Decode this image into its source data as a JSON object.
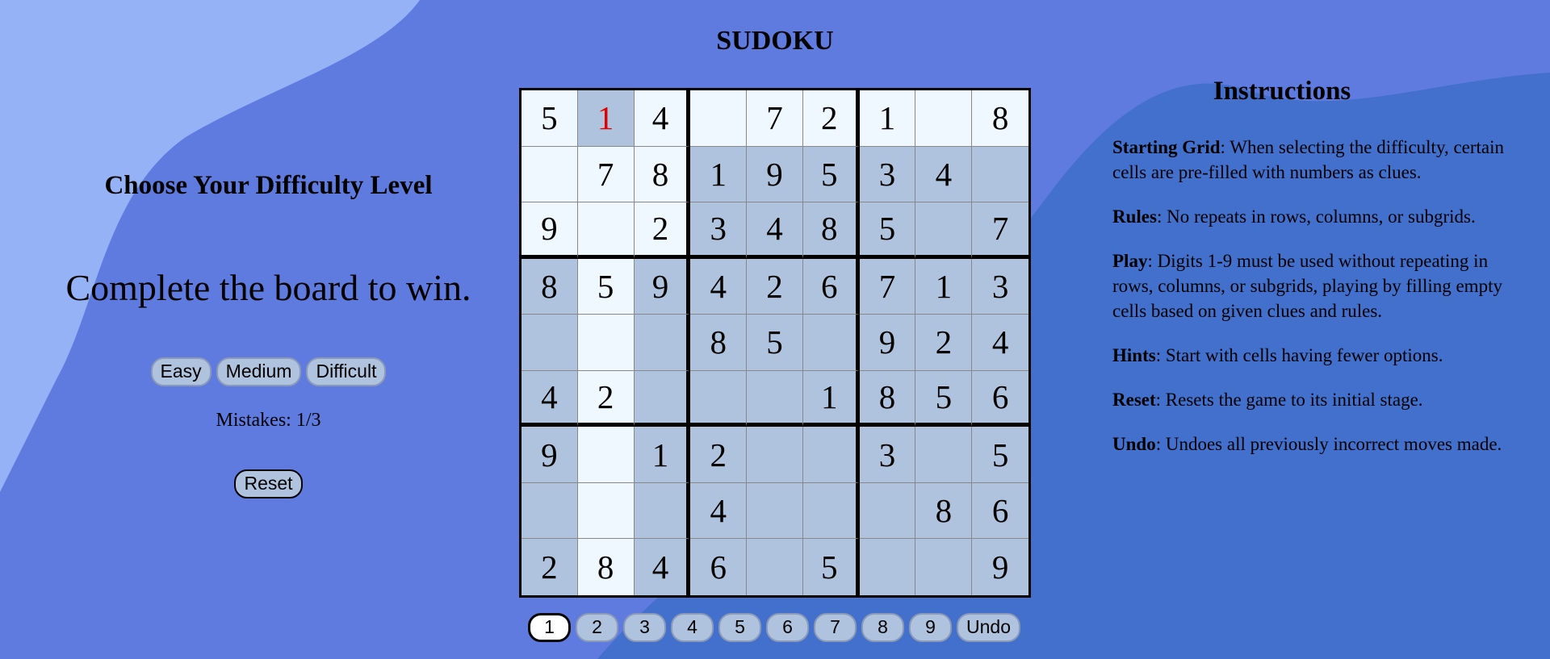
{
  "page": {
    "title": "SUDOKU",
    "colors": {
      "background": "#5f7be0",
      "blob_light": "#94b2f5",
      "blob_dark": "#4270cc",
      "cell_given": "#b0c3de",
      "cell_empty": "#f0f8ff",
      "error_digit": "#e00000"
    }
  },
  "left": {
    "difficulty_heading": "Choose Your Difficulty Level",
    "win_text": "Complete the board to win.",
    "difficulty_buttons": [
      "Easy",
      "Medium",
      "Difficult"
    ],
    "mistakes": "Mistakes: 1/3",
    "reset_label": "Reset"
  },
  "board": {
    "selected_cell": "r0c1",
    "rows": [
      [
        {
          "v": "5",
          "t": "empty"
        },
        {
          "v": "1",
          "t": "selected"
        },
        {
          "v": "4",
          "t": "empty"
        },
        {
          "v": "",
          "t": "empty"
        },
        {
          "v": "7",
          "t": "empty"
        },
        {
          "v": "2",
          "t": "empty"
        },
        {
          "v": "1",
          "t": "empty"
        },
        {
          "v": "",
          "t": "empty"
        },
        {
          "v": "8",
          "t": "empty"
        }
      ],
      [
        {
          "v": "",
          "t": "empty"
        },
        {
          "v": "7",
          "t": "empty"
        },
        {
          "v": "8",
          "t": "empty"
        },
        {
          "v": "1",
          "t": "given"
        },
        {
          "v": "9",
          "t": "given"
        },
        {
          "v": "5",
          "t": "given"
        },
        {
          "v": "3",
          "t": "given"
        },
        {
          "v": "4",
          "t": "given"
        },
        {
          "v": "",
          "t": "given"
        }
      ],
      [
        {
          "v": "9",
          "t": "empty"
        },
        {
          "v": "",
          "t": "empty"
        },
        {
          "v": "2",
          "t": "empty"
        },
        {
          "v": "3",
          "t": "given"
        },
        {
          "v": "4",
          "t": "given"
        },
        {
          "v": "8",
          "t": "given"
        },
        {
          "v": "5",
          "t": "given"
        },
        {
          "v": "",
          "t": "given"
        },
        {
          "v": "7",
          "t": "given"
        }
      ],
      [
        {
          "v": "8",
          "t": "given"
        },
        {
          "v": "5",
          "t": "empty"
        },
        {
          "v": "9",
          "t": "given"
        },
        {
          "v": "4",
          "t": "given"
        },
        {
          "v": "2",
          "t": "given"
        },
        {
          "v": "6",
          "t": "given"
        },
        {
          "v": "7",
          "t": "given"
        },
        {
          "v": "1",
          "t": "given"
        },
        {
          "v": "3",
          "t": "given"
        }
      ],
      [
        {
          "v": "",
          "t": "given"
        },
        {
          "v": "",
          "t": "empty"
        },
        {
          "v": "",
          "t": "given"
        },
        {
          "v": "8",
          "t": "given"
        },
        {
          "v": "5",
          "t": "given"
        },
        {
          "v": "",
          "t": "given"
        },
        {
          "v": "9",
          "t": "given"
        },
        {
          "v": "2",
          "t": "given"
        },
        {
          "v": "4",
          "t": "given"
        }
      ],
      [
        {
          "v": "4",
          "t": "given"
        },
        {
          "v": "2",
          "t": "empty"
        },
        {
          "v": "",
          "t": "given"
        },
        {
          "v": "",
          "t": "given"
        },
        {
          "v": "",
          "t": "given"
        },
        {
          "v": "1",
          "t": "given"
        },
        {
          "v": "8",
          "t": "given"
        },
        {
          "v": "5",
          "t": "given"
        },
        {
          "v": "6",
          "t": "given"
        }
      ],
      [
        {
          "v": "9",
          "t": "given"
        },
        {
          "v": "",
          "t": "empty"
        },
        {
          "v": "1",
          "t": "given"
        },
        {
          "v": "2",
          "t": "given"
        },
        {
          "v": "",
          "t": "given"
        },
        {
          "v": "",
          "t": "given"
        },
        {
          "v": "3",
          "t": "given"
        },
        {
          "v": "",
          "t": "given"
        },
        {
          "v": "5",
          "t": "given"
        }
      ],
      [
        {
          "v": "",
          "t": "given"
        },
        {
          "v": "",
          "t": "empty"
        },
        {
          "v": "",
          "t": "given"
        },
        {
          "v": "4",
          "t": "given"
        },
        {
          "v": "",
          "t": "given"
        },
        {
          "v": "",
          "t": "given"
        },
        {
          "v": "",
          "t": "given"
        },
        {
          "v": "8",
          "t": "given"
        },
        {
          "v": "6",
          "t": "given"
        }
      ],
      [
        {
          "v": "2",
          "t": "given"
        },
        {
          "v": "8",
          "t": "empty"
        },
        {
          "v": "4",
          "t": "given"
        },
        {
          "v": "6",
          "t": "given"
        },
        {
          "v": "",
          "t": "given"
        },
        {
          "v": "5",
          "t": "given"
        },
        {
          "v": "",
          "t": "given"
        },
        {
          "v": "",
          "t": "given"
        },
        {
          "v": "9",
          "t": "given"
        }
      ]
    ]
  },
  "numpad": {
    "digits": [
      "1",
      "2",
      "3",
      "4",
      "5",
      "6",
      "7",
      "8",
      "9"
    ],
    "active_digit": "1",
    "undo_label": "Undo"
  },
  "instructions": {
    "heading": "Instructions",
    "items": [
      {
        "term": "Starting Grid",
        "text": ": When selecting the difficulty, certain cells are pre-filled with numbers as clues."
      },
      {
        "term": "Rules",
        "text": ": No repeats in rows, columns, or subgrids."
      },
      {
        "term": "Play",
        "text": ": Digits 1-9 must be used without repeating in rows, columns, or subgrids, playing by filling empty cells based on given clues and rules."
      },
      {
        "term": "Hints",
        "text": ": Start with cells having fewer options."
      },
      {
        "term": "Reset",
        "text": ": Resets the game to its initial stage."
      },
      {
        "term": "Undo",
        "text": ": Undoes all previously incorrect moves made."
      }
    ]
  }
}
